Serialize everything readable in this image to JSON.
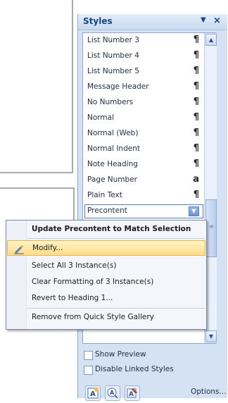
{
  "pane": {
    "title": "Styles",
    "dropdown_glyph": "▼",
    "close_glyph": "×"
  },
  "styles": {
    "items": [
      {
        "label": "List Number 3",
        "mark": "¶"
      },
      {
        "label": "List Number 4",
        "mark": "¶"
      },
      {
        "label": "List Number 5",
        "mark": "¶"
      },
      {
        "label": "Message Header",
        "mark": "¶"
      },
      {
        "label": "No Numbers",
        "mark": "¶"
      },
      {
        "label": "Normal",
        "mark": "¶"
      },
      {
        "label": "Normal (Web)",
        "mark": "¶"
      },
      {
        "label": "Normal Indent",
        "mark": "¶"
      },
      {
        "label": "Note Heading",
        "mark": "¶"
      },
      {
        "label": "Page Number",
        "mark": "a"
      },
      {
        "label": "Plain Text",
        "mark": "¶"
      },
      {
        "label": "Precontent",
        "mark": "▼"
      }
    ],
    "selected": "Precontent"
  },
  "menu": {
    "items": [
      {
        "label": "Update Precontent to Match Selection"
      },
      {
        "label": "Modify..."
      },
      {
        "label": "Select All 3 Instance(s)"
      },
      {
        "label": "Clear Formatting of 3 Instance(s)"
      },
      {
        "label": "Revert to Heading 1..."
      },
      {
        "label": "Remove from Quick Style Gallery"
      }
    ]
  },
  "bottom": {
    "show_preview_label": "Show Preview",
    "disable_linked_label": "Disable Linked Styles",
    "options_label": "Options..."
  },
  "scroll": {
    "up_glyph": "▲",
    "down_glyph": "▼"
  },
  "icons": {
    "modify": "modify-style-icon",
    "new_style": "new-style-icon",
    "style_inspector": "style-inspector-icon",
    "manage_styles": "manage-styles-icon"
  }
}
